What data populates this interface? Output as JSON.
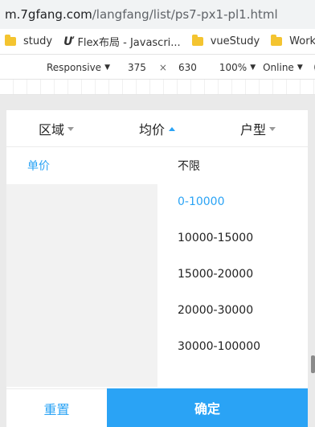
{
  "browser": {
    "url_host": "m.7gfang.com",
    "url_path": "/langfang/list/ps7-px1-pl1.html",
    "bookmarks": [
      {
        "label": "study",
        "icon": "folder-icon"
      },
      {
        "label": "Flex布局 - Javascri...",
        "icon": "flex-icon"
      },
      {
        "label": "vueStudy",
        "icon": "folder-icon"
      },
      {
        "label": "Work",
        "icon": "folder-icon"
      }
    ],
    "flex_icon_glyph": "Ư"
  },
  "devtools": {
    "device": "Responsive",
    "width": "375",
    "times": "×",
    "height": "630",
    "zoom": "100%",
    "network": "Online",
    "caret": "▼"
  },
  "filter": {
    "tabs": [
      {
        "label": "区域",
        "state": "collapsed"
      },
      {
        "label": "均价",
        "state": "expanded"
      },
      {
        "label": "户型",
        "state": "collapsed"
      }
    ],
    "left_item": "单价",
    "options": [
      "不限",
      "0-10000",
      "10000-15000",
      "15000-20000",
      "20000-30000",
      "30000-100000"
    ],
    "selected_option": "0-10000",
    "reset_label": "重置",
    "confirm_label": "确定"
  },
  "colors": {
    "accent": "#2aa3f5",
    "text": "#222222",
    "panel_gray": "#f2f2f2"
  }
}
